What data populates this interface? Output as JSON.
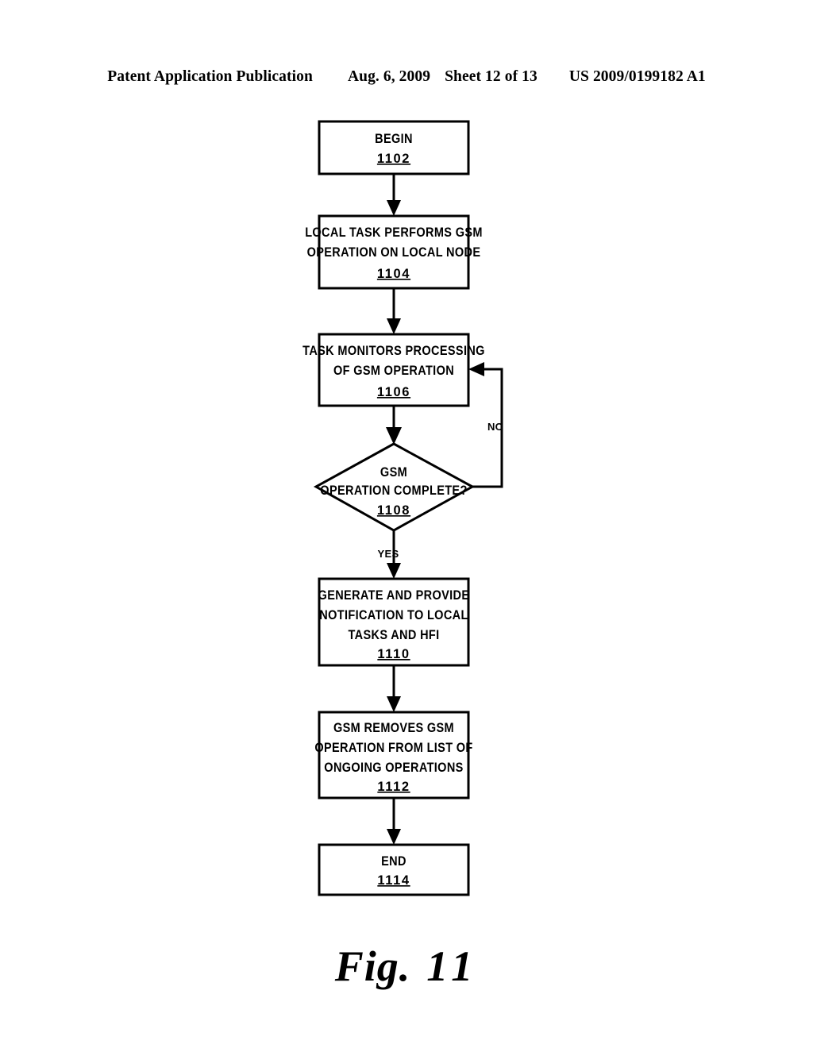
{
  "header": {
    "publication": "Patent Application Publication",
    "date": "Aug. 6, 2009",
    "sheet": "Sheet 12 of 13",
    "patent_number": "US 2009/0199182 A1"
  },
  "figure": {
    "caption_word": "Fig.",
    "caption_number": "11",
    "ink_color": "#000000",
    "paper_color": "#ffffff"
  },
  "flowchart": {
    "nodes": [
      {
        "id": "1102",
        "shape": "rect",
        "lines": [
          "BEGIN"
        ],
        "ref": "1102"
      },
      {
        "id": "1104",
        "shape": "rect",
        "lines": [
          "LOCAL TASK PERFORMS GSM",
          "OPERATION ON LOCAL NODE"
        ],
        "ref": "1104"
      },
      {
        "id": "1106",
        "shape": "rect",
        "lines": [
          "TASK MONITORS PROCESSING",
          "OF GSM OPERATION"
        ],
        "ref": "1106"
      },
      {
        "id": "1108",
        "shape": "diamond",
        "lines": [
          "GSM",
          "OPERATION COMPLETE?"
        ],
        "ref": "1108"
      },
      {
        "id": "1110",
        "shape": "rect",
        "lines": [
          "GENERATE AND PROVIDE",
          "NOTIFICATION TO LOCAL",
          "TASKS AND HFI"
        ],
        "ref": "1110"
      },
      {
        "id": "1112",
        "shape": "rect",
        "lines": [
          "GSM REMOVES GSM",
          "OPERATION FROM LIST OF",
          "ONGOING OPERATIONS"
        ],
        "ref": "1112"
      },
      {
        "id": "1114",
        "shape": "rect",
        "lines": [
          "END"
        ],
        "ref": "1114"
      }
    ],
    "edges": [
      {
        "id": "e-1102-1104",
        "from": "1102",
        "to": "1104",
        "label": ""
      },
      {
        "id": "e-1104-1106",
        "from": "1104",
        "to": "1106",
        "label": ""
      },
      {
        "id": "e-1106-1108",
        "from": "1106",
        "to": "1108",
        "label": ""
      },
      {
        "id": "e-1108-1106",
        "from": "1108",
        "to": "1106",
        "label": "NO"
      },
      {
        "id": "e-1108-1110",
        "from": "1108",
        "to": "1110",
        "label": "YES"
      },
      {
        "id": "e-1110-1112",
        "from": "1110",
        "to": "1112",
        "label": ""
      },
      {
        "id": "e-1112-1114",
        "from": "1112",
        "to": "1114",
        "label": ""
      }
    ]
  }
}
